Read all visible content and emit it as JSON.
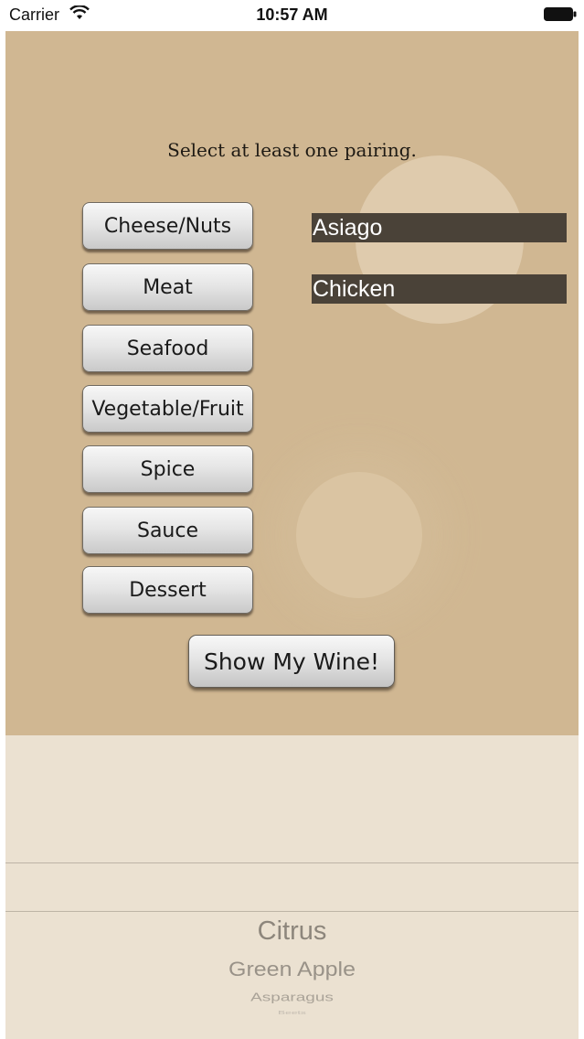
{
  "status_bar": {
    "carrier": "Carrier",
    "time": "10:57 AM"
  },
  "prompt": "Select at least one pairing.",
  "pairings": [
    {
      "label": "Cheese/Nuts"
    },
    {
      "label": "Meat"
    },
    {
      "label": "Seafood"
    },
    {
      "label": "Vegetable/Fruit"
    },
    {
      "label": "Spice"
    },
    {
      "label": "Sauce"
    },
    {
      "label": "Dessert"
    }
  ],
  "selections": [
    "Asiago",
    "Chicken"
  ],
  "show_button": "Show My Wine!",
  "picker": {
    "items": [
      "Citrus",
      "Green Apple",
      "Asparagus",
      "Beets"
    ]
  },
  "colors": {
    "background": "#d0b792",
    "picker_background": "#ebe1d1",
    "selection_field": "#4a4238"
  }
}
